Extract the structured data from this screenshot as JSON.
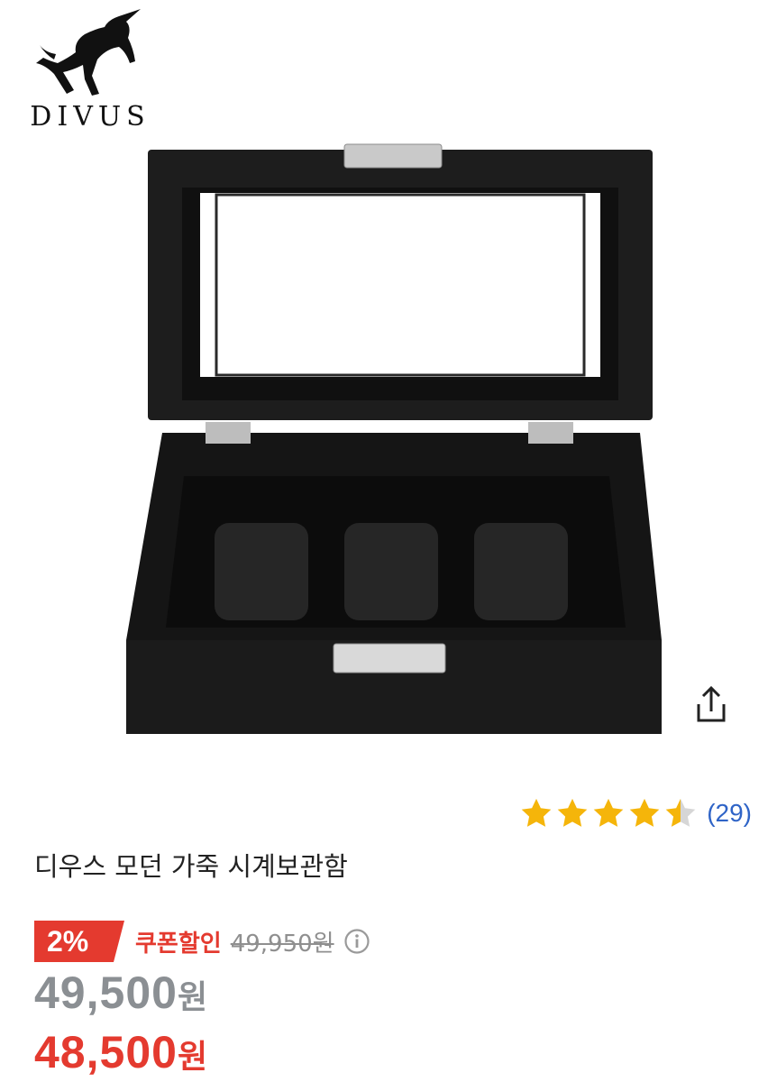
{
  "brand": {
    "name": "DIVUS",
    "logo_icon": "rearing-unicorn-icon"
  },
  "product": {
    "image_alt": "black carbon-texture watch box with 3 slots",
    "title": "디우스 모던 가죽 시계보관함"
  },
  "share": {
    "icon": "share-icon"
  },
  "rating": {
    "value": 4.5,
    "max": 5,
    "count_text": "(29)",
    "star_color": "#f5b50a"
  },
  "pricing": {
    "discount_badge": "2%",
    "coupon_label": "쿠폰할인",
    "original_price": "49,950원",
    "info_icon": "info-icon",
    "current_price_number": "49,500",
    "coupon_price_number": "48,500",
    "currency_unit": "원",
    "accent_color": "#e43a2f"
  }
}
